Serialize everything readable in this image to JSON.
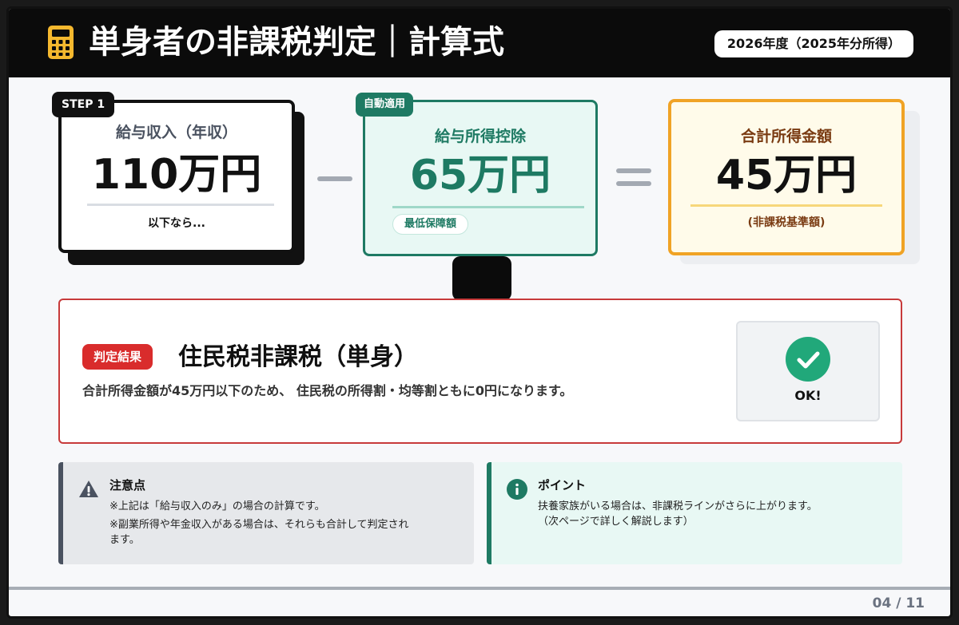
{
  "header": {
    "title": "単身者の非課税判定｜計算式",
    "year_badge": "2026年度（2025年分所得）",
    "icon": "calculator-icon"
  },
  "step1": {
    "tag": "STEP 1",
    "label": "給与収入（年収）",
    "value": "110万円",
    "note": "以下なら..."
  },
  "operator_minus": "minus-icon",
  "step2": {
    "tag": "自動適用",
    "label": "給与所得控除",
    "value": "65万円",
    "note": "最低保障額"
  },
  "operator_equals": "equals-icon",
  "step3": {
    "label": "合計所得金額",
    "value": "45万円",
    "note": "(非課税基準額)"
  },
  "result": {
    "tag": "判定結果",
    "title": "住民税非課税（単身）",
    "description": "合計所得金額が45万円以下のため、 住民税の所得割・均等割ともに0円になります。",
    "status": "OK!"
  },
  "notes": {
    "caution": {
      "icon": "warning-icon",
      "title": "注意点",
      "lines": [
        "※上記は「給与収入のみ」の場合の計算です。",
        "※副業所得や年金収入がある場合は、それらも合計して判定され\nます。"
      ]
    },
    "point": {
      "icon": "info-icon",
      "title": "ポイント",
      "lines": [
        "扶養家族がいる場合は、非課税ラインがさらに上がります。",
        "（次ページで詳しく解説します）"
      ]
    }
  },
  "footer": {
    "page": "04 / 11"
  },
  "colors": {
    "header_bg": "#0b0b0b",
    "accent_green": "#1e7a63",
    "accent_orange": "#f0a325",
    "alert_red": "#d92c2c",
    "ok_green": "#21a87a"
  }
}
